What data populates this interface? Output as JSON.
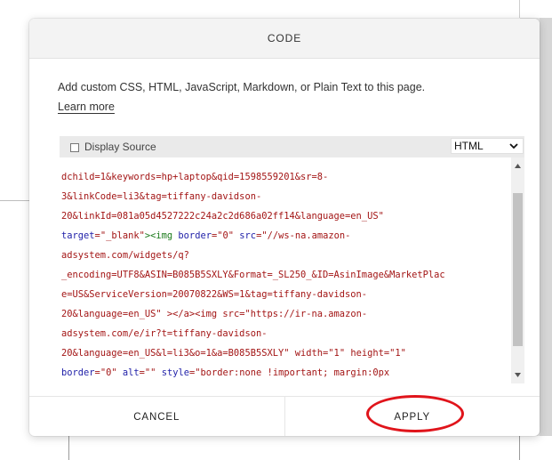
{
  "dialog": {
    "title": "CODE",
    "description": "Add custom CSS, HTML, JavaScript, Markdown, or Plain Text to this page.",
    "learn_more": "Learn more",
    "display_source_label": "Display Source",
    "language_selected": "HTML",
    "icons": {
      "checkbox": "checkbox-icon",
      "select": "chevron-down-icon",
      "scroll_up": "triangle-up-icon",
      "scroll_down": "triangle-down-icon"
    },
    "code_lines": [
      "        ’ ’    ’        ’    ’",
      "dchild=1&keywords=hp+laptop&qid=1598559201&sr=8-",
      "3&linkCode=li3&tag=tiffany-davidson-",
      "20&linkId=081a05d4527222c24a2c2d686a02ff14&language=en_US\"",
      "target=\"_blank\"><img border=\"0\" src=\"//ws-na.amazon-",
      "adsystem.com/widgets/q?",
      "_encoding=UTF8&ASIN=B085B5SXLY&Format=_SL250_&ID=AsinImage&MarketPlac",
      "e=US&ServiceVersion=20070822&WS=1&tag=tiffany-davidson-",
      "20&language=en_US\" ></a><img src=\"https://ir-na.amazon-",
      "adsystem.com/e/ir?t=tiffany-davidson-",
      "20&language=en_US&l=li3&o=1&a=B085B5SXLY\" width=\"1\" height=\"1\"",
      "border=\"0\" alt=\"\" style=\"border:none !important; margin:0px"
    ],
    "cancel_label": "CANCEL",
    "apply_label": "APPLY"
  },
  "colors": {
    "annotation": "#e0141b",
    "code_string": "#a31515",
    "code_attr": "#1f1fa8",
    "code_tag": "#1a7a1a"
  }
}
